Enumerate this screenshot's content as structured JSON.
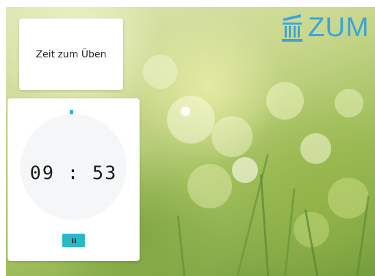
{
  "title_card": {
    "text": "Zeit zum Üben"
  },
  "timer": {
    "display": "09 : 53",
    "pause_button_icon": "pause-icon"
  },
  "logo": {
    "text": "ZUM",
    "icon": "pillar-icon"
  },
  "colors": {
    "accent": "#2ab8c8",
    "logo_blue": "#3aa4db",
    "dial_bg": "#f4f6f7"
  }
}
